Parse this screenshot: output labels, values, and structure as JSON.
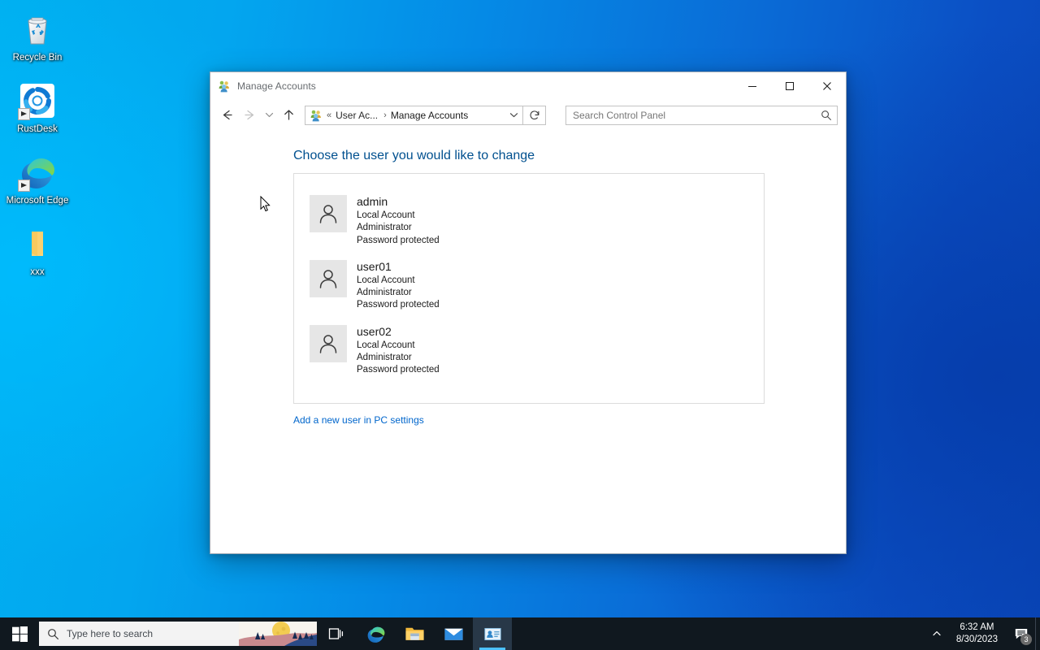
{
  "desktop": {
    "icons": [
      {
        "label": "Recycle Bin",
        "icon": "recycle-bin-icon",
        "shortcut": false
      },
      {
        "label": "RustDesk",
        "icon": "rustdesk-icon",
        "shortcut": true
      },
      {
        "label": "Microsoft Edge",
        "icon": "microsoft-edge-icon",
        "shortcut": true
      },
      {
        "label": "xxx",
        "icon": "folder-icon",
        "shortcut": false
      }
    ],
    "wallpaper_left_color": "#00b0f0",
    "wallpaper_right_color": "#0b4fc4"
  },
  "window": {
    "title": "Manage Accounts",
    "title_icon": "user-accounts-icon",
    "controls": {
      "minimize": "minimize-icon",
      "maximize": "maximize-icon",
      "close": "close-icon"
    },
    "toolbar": {
      "back": "back-arrow-icon",
      "forward": "forward-arrow-icon",
      "recent": "chevron-down-icon",
      "up": "up-arrow-icon",
      "refresh": "refresh-icon",
      "address_icon": "user-accounts-icon",
      "address_prefix": "«",
      "breadcrumbs": [
        {
          "label": "User Ac..."
        },
        {
          "label": "Manage Accounts"
        }
      ],
      "separator": "›",
      "address_dropdown": "chevron-down-icon",
      "search": {
        "placeholder": "Search Control Panel",
        "value": "",
        "icon": "search-icon"
      }
    },
    "content": {
      "heading": "Choose the user you would like to change",
      "heading_color": "#00508f",
      "users": [
        {
          "name": "admin",
          "account_type": "Local Account",
          "role": "Administrator",
          "password_status": "Password protected",
          "avatar": "user-avatar-icon"
        },
        {
          "name": "user01",
          "account_type": "Local Account",
          "role": "Administrator",
          "password_status": "Password protected",
          "avatar": "user-avatar-icon"
        },
        {
          "name": "user02",
          "account_type": "Local Account",
          "role": "Administrator",
          "password_status": "Password protected",
          "avatar": "user-avatar-icon"
        }
      ],
      "add_user_link": "Add a new user in PC settings",
      "link_color": "#0066cc"
    }
  },
  "taskbar": {
    "start": "windows-logo-icon",
    "search": {
      "placeholder": "Type here to search",
      "icon": "search-icon"
    },
    "items": [
      {
        "name": "task-view",
        "icon": "task-view-icon",
        "active": false
      },
      {
        "name": "microsoft-edge",
        "icon": "microsoft-edge-icon",
        "active": false
      },
      {
        "name": "file-explorer",
        "icon": "file-explorer-icon",
        "active": false
      },
      {
        "name": "mail",
        "icon": "mail-icon",
        "active": false
      },
      {
        "name": "manage-accounts",
        "icon": "user-accounts-icon",
        "active": true
      }
    ],
    "tray": {
      "show_hidden": "chevron-up-icon",
      "time": "6:32 AM",
      "date": "8/30/2023",
      "notifications_icon": "notification-icon",
      "notifications_count": "3"
    }
  }
}
